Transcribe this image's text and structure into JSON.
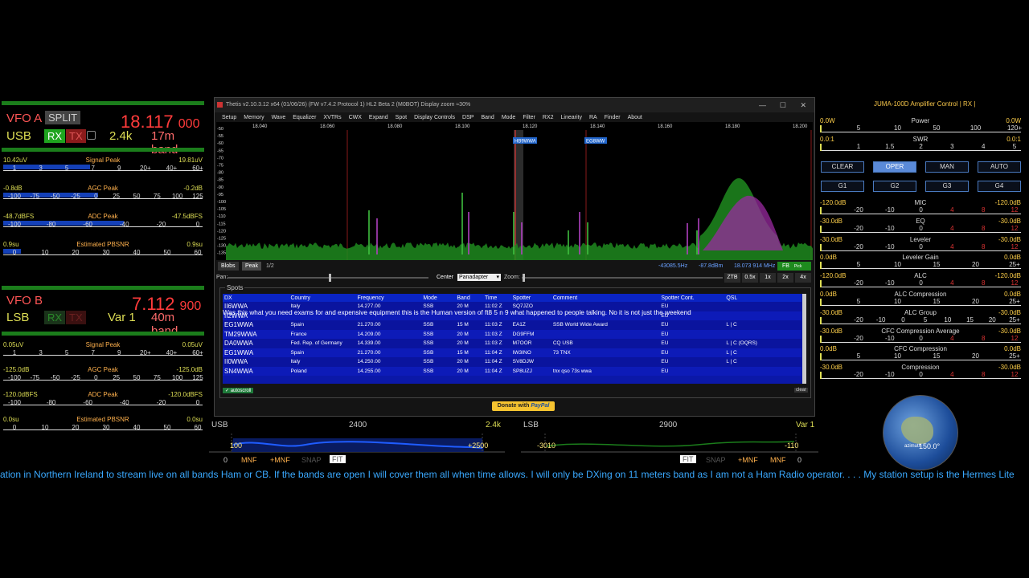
{
  "vfo_a": {
    "name": "VFO A",
    "split": "SPLIT",
    "mode": "USB",
    "rx": "RX",
    "tx": "TX",
    "freq_main": "18.117",
    "freq_sub": "000",
    "filter": "2.4k",
    "band": "17m band",
    "meters": [
      {
        "left": "10.42uV",
        "title": "Signal Peak",
        "right": "19.81uV",
        "ticks": [
          "1",
          "3",
          "5",
          "7",
          "9",
          "20+",
          "40+",
          "60+"
        ]
      },
      {
        "left": "-0.8dB",
        "title": "AGC Peak",
        "right": "-0.2dB",
        "ticks": [
          "-100",
          "-75",
          "-50",
          "-25",
          "0",
          "25",
          "50",
          "75",
          "100",
          "125"
        ]
      },
      {
        "left": "-48.7dBFS",
        "title": "ADC Peak",
        "right": "-47.5dBFS",
        "ticks": [
          "-100",
          "-80",
          "-60",
          "-40",
          "-20",
          "0"
        ]
      },
      {
        "left": "0.9su",
        "title": "Estimated PBSNR",
        "right": "0.9su",
        "ticks": [
          "0",
          "10",
          "20",
          "30",
          "40",
          "50",
          "60"
        ]
      }
    ]
  },
  "vfo_b": {
    "name": "VFO B",
    "mode": "LSB",
    "rx": "RX",
    "tx": "TX",
    "freq_main": "7.112",
    "freq_sub": "900",
    "filter": "Var 1",
    "band": "40m band",
    "meters": [
      {
        "left": "0.05uV",
        "title": "Signal Peak",
        "right": "0.05uV",
        "ticks": [
          "1",
          "3",
          "5",
          "7",
          "9",
          "20+",
          "40+",
          "60+"
        ]
      },
      {
        "left": "-125.0dB",
        "title": "AGC Peak",
        "right": "-125.0dB",
        "ticks": [
          "-100",
          "-75",
          "-50",
          "-25",
          "0",
          "25",
          "50",
          "75",
          "100",
          "125"
        ]
      },
      {
        "left": "-120.0dBFS",
        "title": "ADC Peak",
        "right": "-120.0dBFS",
        "ticks": [
          "-100",
          "-80",
          "-60",
          "-40",
          "-20",
          "0"
        ]
      },
      {
        "left": "0.0su",
        "title": "Estimated PBSNR",
        "right": "0.0su",
        "ticks": [
          "0",
          "10",
          "20",
          "30",
          "40",
          "50",
          "60"
        ]
      }
    ]
  },
  "window": {
    "title": "Thetis v2.10.3.12 x64 (01/06/26) (FW v7.4.2 Protocol 1) HL2 Beta 2 (M0BOT)  Display zoom ≈30%",
    "menu": [
      "Setup",
      "Memory",
      "Wave",
      "Equalizer",
      "XVTRs",
      "CWX",
      "Expand",
      "Spot",
      "Display Controls",
      "DSP",
      "Band",
      "Mode",
      "Filter",
      "RX2",
      "Linearity",
      "RA",
      "Finder",
      "About"
    ],
    "freq_scale": [
      "18.040",
      "18.060",
      "18.080",
      "18.100",
      "18.120",
      "18.140",
      "18.160",
      "18.180",
      "18.200"
    ],
    "db_scale": [
      "-50",
      "-55",
      "-60",
      "-65",
      "-70",
      "-75",
      "-80",
      "-85",
      "-90",
      "-95",
      "-100",
      "-105",
      "-110",
      "-115",
      "-120",
      "-125",
      "-130",
      "-135"
    ],
    "spot_labels": [
      "HB9WWA",
      "EG8WW"
    ],
    "status": {
      "blobs": "Blobs",
      "peak": "Peak",
      "ratio": "1/2",
      "offset": "-43085.5Hz",
      "level": "-87.8dBm",
      "freq": "18.073 914 MHz",
      "fb": "FB",
      "fb_sub": "Pick Signal"
    },
    "pan_label": "Pan:",
    "center": "Center",
    "display_mode": "Panadapter",
    "zoom_label": "Zoom:",
    "zoom_buttons": [
      "ZTB",
      "0.5x",
      "1x",
      "2x",
      "4x"
    ]
  },
  "spots": {
    "title": "Spots",
    "headers": [
      "DX",
      "Country",
      "Frequency",
      "Mode",
      "Band",
      "Time",
      "Spotter",
      "Comment",
      "Spotter Cont.",
      "QSL"
    ],
    "rows": [
      [
        "II6WWA",
        "Italy",
        "14.277.00",
        "SSB",
        "20 M",
        "11:02 Z",
        "SQ7JZO",
        "",
        "EU",
        ""
      ],
      [
        "II2WWA",
        "",
        "",
        "",
        "",
        "",
        "",
        "",
        "EU",
        ""
      ],
      [
        "EG1WWA",
        "Spain",
        "21.270.00",
        "SSB",
        "15 M",
        "11:03 Z",
        "EA1Z",
        "SSB World Wide Award",
        "EU",
        "L | C"
      ],
      [
        "TM29WWA",
        "France",
        "14.209.00",
        "SSB",
        "20 M",
        "11:03 Z",
        "DG9FFM",
        "",
        "EU",
        ""
      ],
      [
        "DA0WWA",
        "Fed. Rep. of Germany",
        "14.339.00",
        "SSB",
        "20 M",
        "11:03 Z",
        "M7OOR",
        "CQ USB",
        "EU",
        "L | C (OQRS)"
      ],
      [
        "EG1WWA",
        "Spain",
        "21.270.00",
        "SSB",
        "15 M",
        "11:04 Z",
        "IW3INO",
        "73 TNX",
        "EU",
        "L | C"
      ],
      [
        "II0WWA",
        "Italy",
        "14.250.00",
        "SSB",
        "20 M",
        "11:04 Z",
        "SV8DJW",
        "",
        "EU",
        "L | C"
      ],
      [
        "SN4WWA",
        "Poland",
        "14.255.00",
        "SSB",
        "20 M",
        "11:04 Z",
        "SP8UZJ",
        "tnx qso 73s  wwa",
        "EU",
        ""
      ]
    ],
    "overlay": "Was this what you need exams for and expensive equipment this is the Human version of ft8  5 n 9 what happened to people talking. No it is not just the weekend",
    "autoscroll": "autoscroll",
    "clear": "clear"
  },
  "donate": {
    "label": "Donate with",
    "brand": "PayPal"
  },
  "amp": {
    "title": "JUMA-100D Amplifier Control | RX |",
    "power": {
      "left": "0.0W",
      "title": "Power",
      "right": "0.0W",
      "ticks": [
        "5",
        "10",
        "50",
        "100",
        "120+"
      ]
    },
    "swr": {
      "left": "0.0:1",
      "title": "SWR",
      "right": "0.0:1",
      "ticks": [
        "1",
        "1.5",
        "2",
        "3",
        "4",
        "5"
      ]
    },
    "mode_buttons": [
      "CLEAR",
      "OPER",
      "MAN",
      "AUTO"
    ],
    "group_buttons": [
      "G1",
      "G2",
      "G3",
      "G4"
    ],
    "meters": [
      {
        "left": "-120.0dB",
        "title": "MIC",
        "right": "-120.0dB",
        "ticks": [
          "-20",
          "-10",
          "0",
          "4",
          "8",
          "12"
        ]
      },
      {
        "left": "-30.0dB",
        "title": "EQ",
        "right": "-30.0dB",
        "ticks": [
          "-20",
          "-10",
          "0",
          "4",
          "8",
          "12"
        ]
      },
      {
        "left": "-30.0dB",
        "title": "Leveler",
        "right": "-30.0dB",
        "ticks": [
          "-20",
          "-10",
          "0",
          "4",
          "8",
          "12"
        ]
      },
      {
        "left": "0.0dB",
        "title": "Leveler Gain",
        "right": "0.0dB",
        "ticks": [
          "5",
          "10",
          "15",
          "20",
          "25+"
        ]
      },
      {
        "left": "-120.0dB",
        "title": "ALC",
        "right": "-120.0dB",
        "ticks": [
          "-20",
          "-10",
          "0",
          "4",
          "8",
          "12"
        ]
      },
      {
        "left": "0.0dB",
        "title": "ALC Compression",
        "right": "0.0dB",
        "ticks": [
          "5",
          "10",
          "15",
          "20",
          "25+"
        ]
      },
      {
        "left": "-30.0dB",
        "title": "ALC Group",
        "right": "-30.0dB",
        "ticks": [
          "-20",
          "-10",
          "0",
          "5",
          "10",
          "15",
          "20",
          "25+"
        ]
      },
      {
        "left": "-30.0dB",
        "title": "CFC Compression Average",
        "right": "-30.0dB",
        "ticks": [
          "-20",
          "-10",
          "0",
          "4",
          "8",
          "12"
        ]
      },
      {
        "left": "0.0dB",
        "title": "CFC Compression",
        "right": "0.0dB",
        "ticks": [
          "5",
          "10",
          "15",
          "20",
          "25+"
        ]
      },
      {
        "left": "-30.0dB",
        "title": "Compression",
        "right": "-30.0dB",
        "ticks": [
          "-20",
          "-10",
          "0",
          "4",
          "8",
          "12"
        ]
      }
    ]
  },
  "filter_a": {
    "mode": "USB",
    "center": "2400",
    "width": "2.4k",
    "low": "100",
    "high": "+2500",
    "zero": "0",
    "mnf": "MNF",
    "pmnf": "+MNF",
    "snap": "SNAP",
    "fit": "FIT"
  },
  "filter_b": {
    "mode": "LSB",
    "center": "2900",
    "width": "Var 1",
    "low": "-3010",
    "high": "-110",
    "zero": "0",
    "mnf": "MNF",
    "pmnf": "+MNF",
    "snap": "SNAP",
    "fit": "FIT"
  },
  "globe": {
    "label": "azimuth",
    "bearing": "150.0°"
  },
  "ticker": "ation in Northern Ireland to stream live on all bands Ham or CB. If the bands are open I will cover them all when time allows. I will only be DXing on 11 meters band as I am not a Ham Radio operator.   . . . My station setup is the Hermes Lite"
}
